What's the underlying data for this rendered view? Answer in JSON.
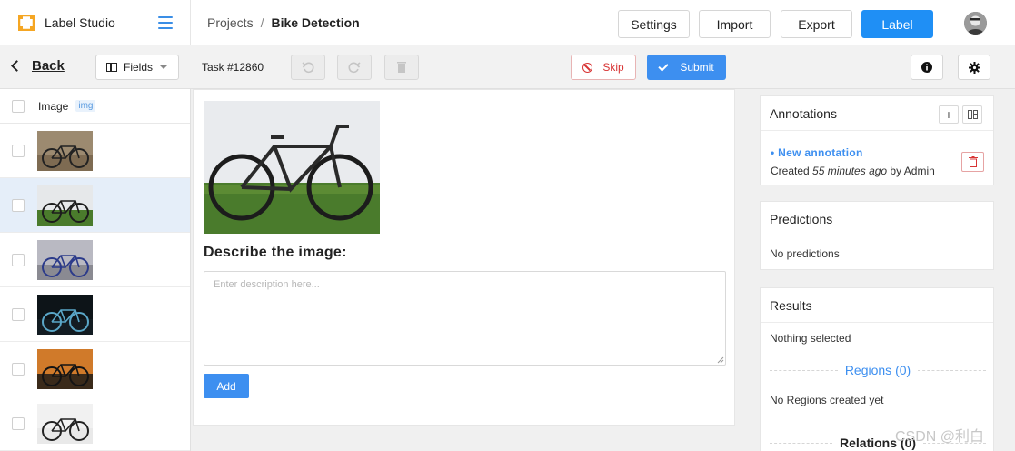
{
  "brand": {
    "name": "Label Studio",
    "accent": "#f5a623"
  },
  "breadcrumb": {
    "projects": "Projects",
    "separator": "/",
    "current": "Bike Detection"
  },
  "top_buttons": {
    "settings": "Settings",
    "import": "Import",
    "export": "Export",
    "label": "Label"
  },
  "toolbar": {
    "back": "Back",
    "fields": "Fields",
    "task_id": "Task #12860",
    "skip": "Skip",
    "submit": "Submit"
  },
  "task_list": {
    "header_label": "Image",
    "header_tag": "img",
    "rows": [
      {
        "selected": false,
        "thumb": "bike on gravel"
      },
      {
        "selected": true,
        "thumb": "bike on grass"
      },
      {
        "selected": false,
        "thumb": "bike on pavement"
      },
      {
        "selected": false,
        "thumb": "bike in dark"
      },
      {
        "selected": false,
        "thumb": "bike at sunset"
      },
      {
        "selected": false,
        "thumb": "bike on white"
      }
    ]
  },
  "labeling": {
    "question": "Describe the image:",
    "textarea_placeholder": "Enter description here...",
    "textarea_value": "",
    "add": "Add"
  },
  "annotations": {
    "title": "Annotations",
    "item_title": "• New annotation",
    "created_prefix": "Created ",
    "created_time": "55 minutes ago",
    "created_suffix": " by Admin"
  },
  "predictions": {
    "title": "Predictions",
    "empty": "No predictions"
  },
  "results": {
    "title": "Results",
    "nothing": "Nothing selected",
    "regions": "Regions (0)",
    "regions_empty": "No Regions created yet",
    "relations": "Relations (0)"
  },
  "watermark": "CSDN @利白",
  "colors": {
    "primary": "#1f8ff5",
    "danger": "#d83434",
    "selected_row": "#e5eef9"
  }
}
